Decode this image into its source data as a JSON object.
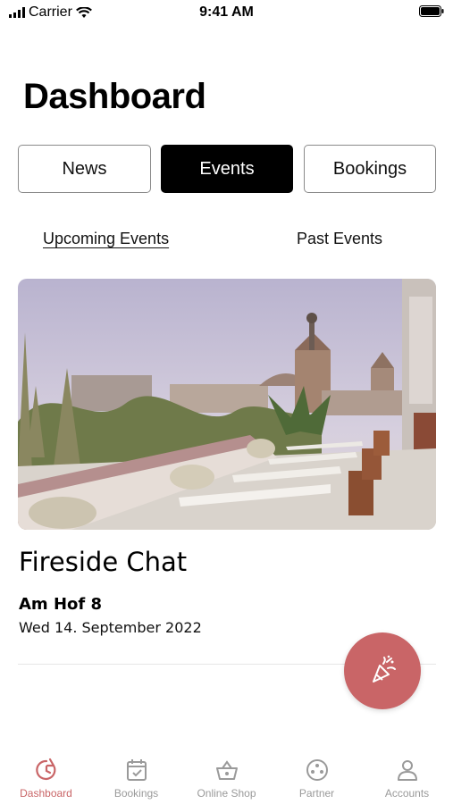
{
  "status_bar": {
    "carrier": "Carrier",
    "time": "9:41 AM"
  },
  "page": {
    "title": "Dashboard"
  },
  "segments": [
    {
      "label": "News",
      "active": false
    },
    {
      "label": "Events",
      "active": true
    },
    {
      "label": "Bookings",
      "active": false
    }
  ],
  "subtabs": [
    {
      "label": "Upcoming Events",
      "active": true
    },
    {
      "label": "Past Events",
      "active": false
    }
  ],
  "event": {
    "title": "Fireside Chat",
    "location": "Am Hof 8",
    "date": "Wed 14. September 2022"
  },
  "fab": {
    "icon": "party-popper-icon"
  },
  "tabbar": {
    "items": [
      {
        "label": "Dashboard",
        "icon": "dashboard-clock-icon",
        "active": true
      },
      {
        "label": "Bookings",
        "icon": "calendar-check-icon",
        "active": false
      },
      {
        "label": "Online Shop",
        "icon": "basket-icon",
        "active": false
      },
      {
        "label": "Partner",
        "icon": "partner-circle-icon",
        "active": false
      },
      {
        "label": "Accounts",
        "icon": "person-icon",
        "active": false
      }
    ]
  },
  "colors": {
    "accent": "#c96567",
    "inactive_tab": "#9a9a9a",
    "segment_active_bg": "#000000"
  }
}
